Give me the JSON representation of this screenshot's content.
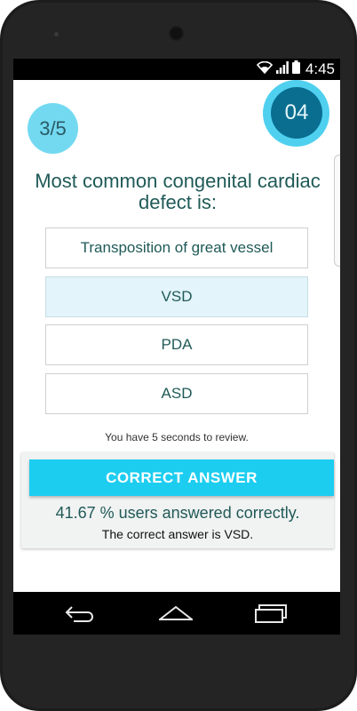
{
  "status_bar": {
    "time": "4:45"
  },
  "quiz": {
    "progress": "3/5",
    "timer": "04",
    "question": "Most common congenital cardiac defect is:",
    "options": [
      {
        "label": "Transposition of great vessel",
        "selected": false
      },
      {
        "label": "VSD",
        "selected": true
      },
      {
        "label": "PDA",
        "selected": false
      },
      {
        "label": "ASD",
        "selected": false
      }
    ],
    "review_note": "You have 5 seconds to review.",
    "result": {
      "button_label": "CORRECT ANSWER",
      "stats": "41.67 % users answered correctly.",
      "answer": "The correct answer is VSD."
    }
  },
  "icons": {
    "wifi": "wifi-icon",
    "signal": "signal-icon",
    "battery": "battery-icon",
    "back": "back-icon",
    "home": "home-icon",
    "recents": "recents-icon"
  },
  "colors": {
    "accent": "#1ccdf0",
    "timer_ring": "#4fd0ef",
    "timer_core": "#0a6e91",
    "progress_badge": "#73d9f1",
    "text_primary": "#1f5a57",
    "selected_option_bg": "#e3f4fb"
  }
}
